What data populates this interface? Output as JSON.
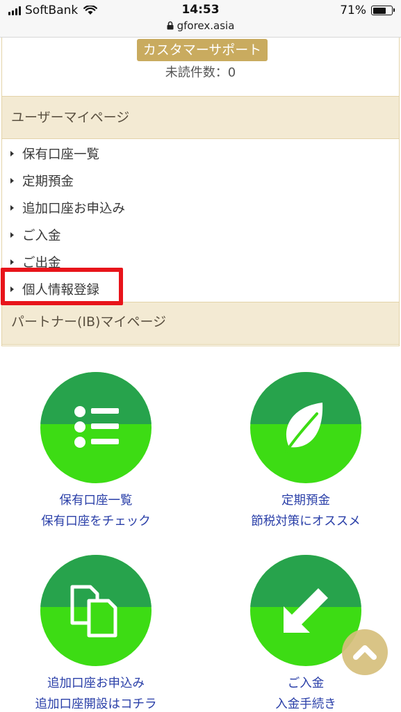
{
  "status_bar": {
    "carrier": "SoftBank",
    "time": "14:53",
    "url": "gforex.asia",
    "battery_percent": "71%",
    "battery_level": 0.71
  },
  "support": {
    "button_label": "カスタマーサポート",
    "unread_label": "未読件数：0"
  },
  "user_section": {
    "title": "ユーザーマイページ",
    "items": [
      {
        "label": "保有口座一覧"
      },
      {
        "label": "定期預金"
      },
      {
        "label": "追加口座お申込み"
      },
      {
        "label": "ご入金"
      },
      {
        "label": "ご出金"
      },
      {
        "label": "個人情報登録"
      }
    ]
  },
  "partner_section": {
    "title": "パートナー(IB)マイページ"
  },
  "tiles": [
    {
      "icon": "list-icon",
      "title": "保有口座一覧",
      "subtitle": "保有口座をチェック"
    },
    {
      "icon": "leaf-icon",
      "title": "定期預金",
      "subtitle": "節税対策にオススメ"
    },
    {
      "icon": "documents-icon",
      "title": "追加口座お申込み",
      "subtitle": "追加口座開設はコチラ"
    },
    {
      "icon": "arrow-down-left-icon",
      "title": "ご入金",
      "subtitle": "入金手続き"
    }
  ],
  "colors": {
    "gold": "#c9ab5f",
    "section_bg": "#f3ead3",
    "circle_top": "#27a34c",
    "circle_bottom": "#3ddc14",
    "link": "#2a3fa8",
    "highlight": "#e8141a"
  }
}
